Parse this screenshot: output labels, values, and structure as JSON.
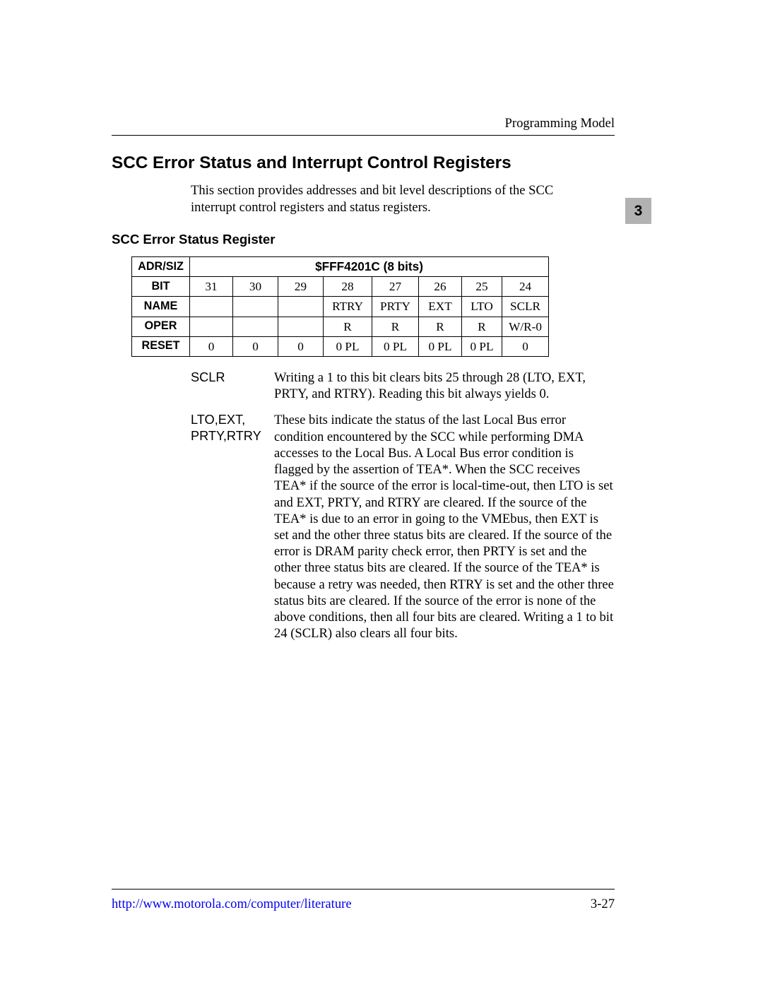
{
  "header": {
    "right": "Programming Model"
  },
  "chapter_tab": "3",
  "section": {
    "title": "SCC Error Status and Interrupt Control Registers",
    "intro": "This section provides addresses and bit level descriptions of the SCC interrupt control registers and status registers."
  },
  "subsection_title": "SCC Error Status Register",
  "register_table": {
    "rows": [
      {
        "label": "ADR/SIZ",
        "span_value": "$FFF4201C (8 bits)"
      },
      {
        "label": "BIT",
        "cells": [
          "31",
          "30",
          "29",
          "28",
          "27",
          "26",
          "25",
          "24"
        ]
      },
      {
        "label": "NAME",
        "cells": [
          "",
          "",
          "",
          "RTRY",
          "PRTY",
          "EXT",
          "LTO",
          "SCLR"
        ]
      },
      {
        "label": "OPER",
        "cells": [
          "",
          "",
          "",
          "R",
          "R",
          "R",
          "R",
          "W/R-0"
        ]
      },
      {
        "label": "RESET",
        "cells": [
          "0",
          "0",
          "0",
          "0 PL",
          "0 PL",
          "0 PL",
          "0 PL",
          "0"
        ]
      }
    ]
  },
  "definitions": [
    {
      "term": "SCLR",
      "body": "Writing a 1 to this bit clears bits 25 through 28 (LTO, EXT, PRTY, and RTRY). Reading this bit always yields 0."
    },
    {
      "term": "LTO,EXT, PRTY,RTRY",
      "body": "These bits indicate the status of the last Local Bus error condition encountered by the SCC while performing DMA accesses to the Local Bus. A Local Bus error condition is flagged by the assertion of TEA*. When the SCC receives TEA* if the source of the error is local-time-out, then LTO is set and EXT, PRTY, and RTRY are cleared. If the source of the TEA* is due to an error in going to the VMEbus, then EXT is set and the other three status bits are cleared. If the source of the error is DRAM parity check error, then PRTY is set and the other three status bits are cleared. If the source of the TEA* is because a retry was needed, then RTRY is set and the other three status bits are cleared. If the source of the error is none of the above conditions, then all four bits are cleared. Writing a 1 to bit 24 (SCLR) also clears all four bits."
    }
  ],
  "footer": {
    "link_text": "http://www.motorola.com/computer/literature",
    "page_number": "3-27"
  }
}
